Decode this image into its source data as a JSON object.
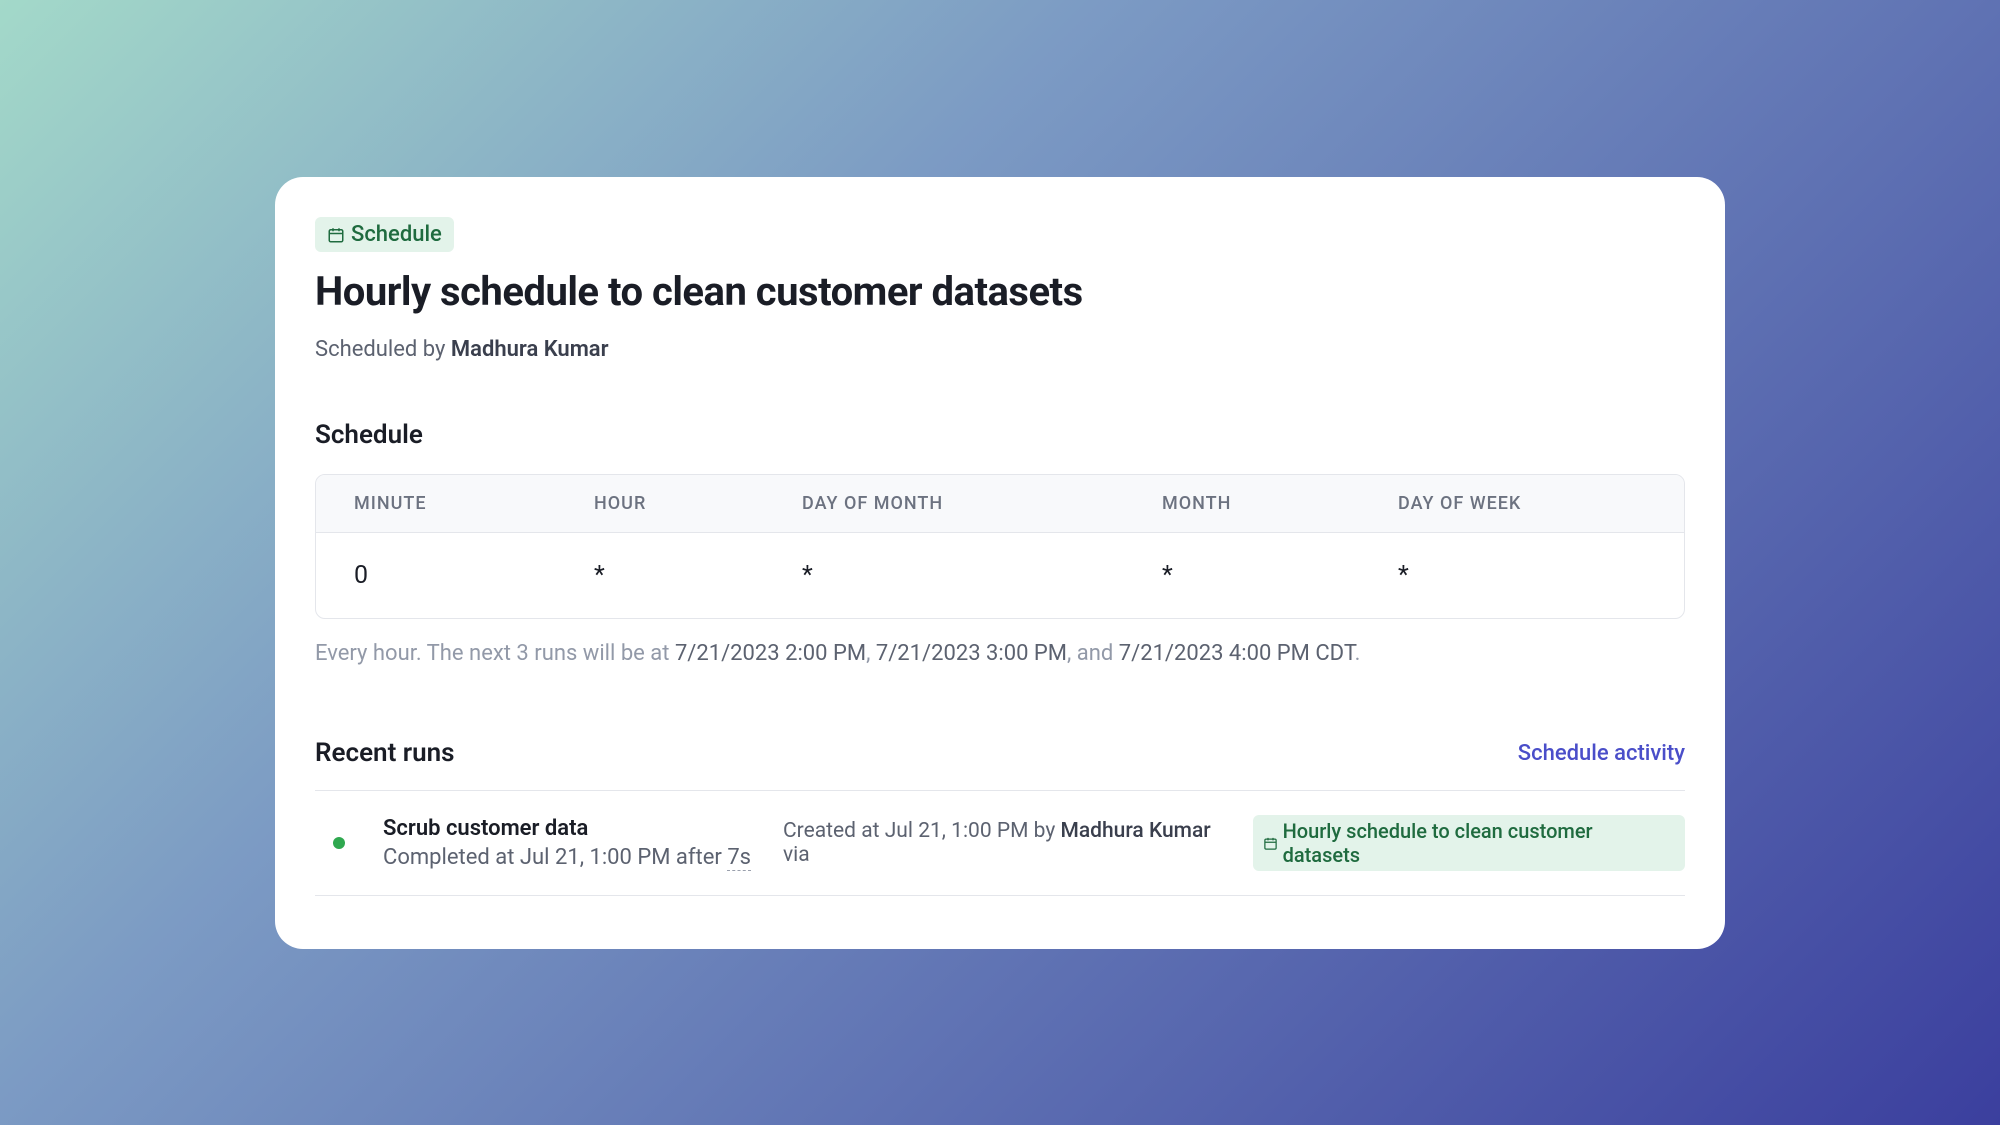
{
  "header": {
    "badge_label": "Schedule",
    "title": "Hourly schedule to clean customer datasets",
    "scheduled_by_prefix": "Scheduled by ",
    "scheduled_by_name": "Madhura Kumar"
  },
  "schedule": {
    "heading": "Schedule",
    "columns": {
      "minute": "MINUTE",
      "hour": "HOUR",
      "day_of_month": "DAY OF MONTH",
      "month": "MONTH",
      "day_of_week": "DAY OF WEEK"
    },
    "values": {
      "minute": "0",
      "hour": "*",
      "day_of_month": "*",
      "month": "*",
      "day_of_week": "*"
    },
    "description": {
      "prefix": "Every hour. The next 3 runs will be at ",
      "run1": "7/21/2023 2:00 PM",
      "sep1": ", ",
      "run2": "7/21/2023 3:00 PM",
      "sep2": ", and ",
      "run3": "7/21/2023 4:00 PM CDT",
      "suffix": "."
    }
  },
  "recent_runs": {
    "heading": "Recent runs",
    "activity_link": "Schedule activity",
    "items": [
      {
        "name": "Scrub customer data",
        "completed_prefix": "Completed at ",
        "completed_time": "Jul 21, 1:00 PM",
        "after_label": " after ",
        "duration": "7s",
        "created_prefix": "Created at ",
        "created_time": "Jul 21, 1:00 PM",
        "by_label": " by ",
        "creator": "Madhura Kumar",
        "via_label": " via ",
        "schedule_badge": "Hourly schedule to clean customer datasets"
      }
    ]
  }
}
